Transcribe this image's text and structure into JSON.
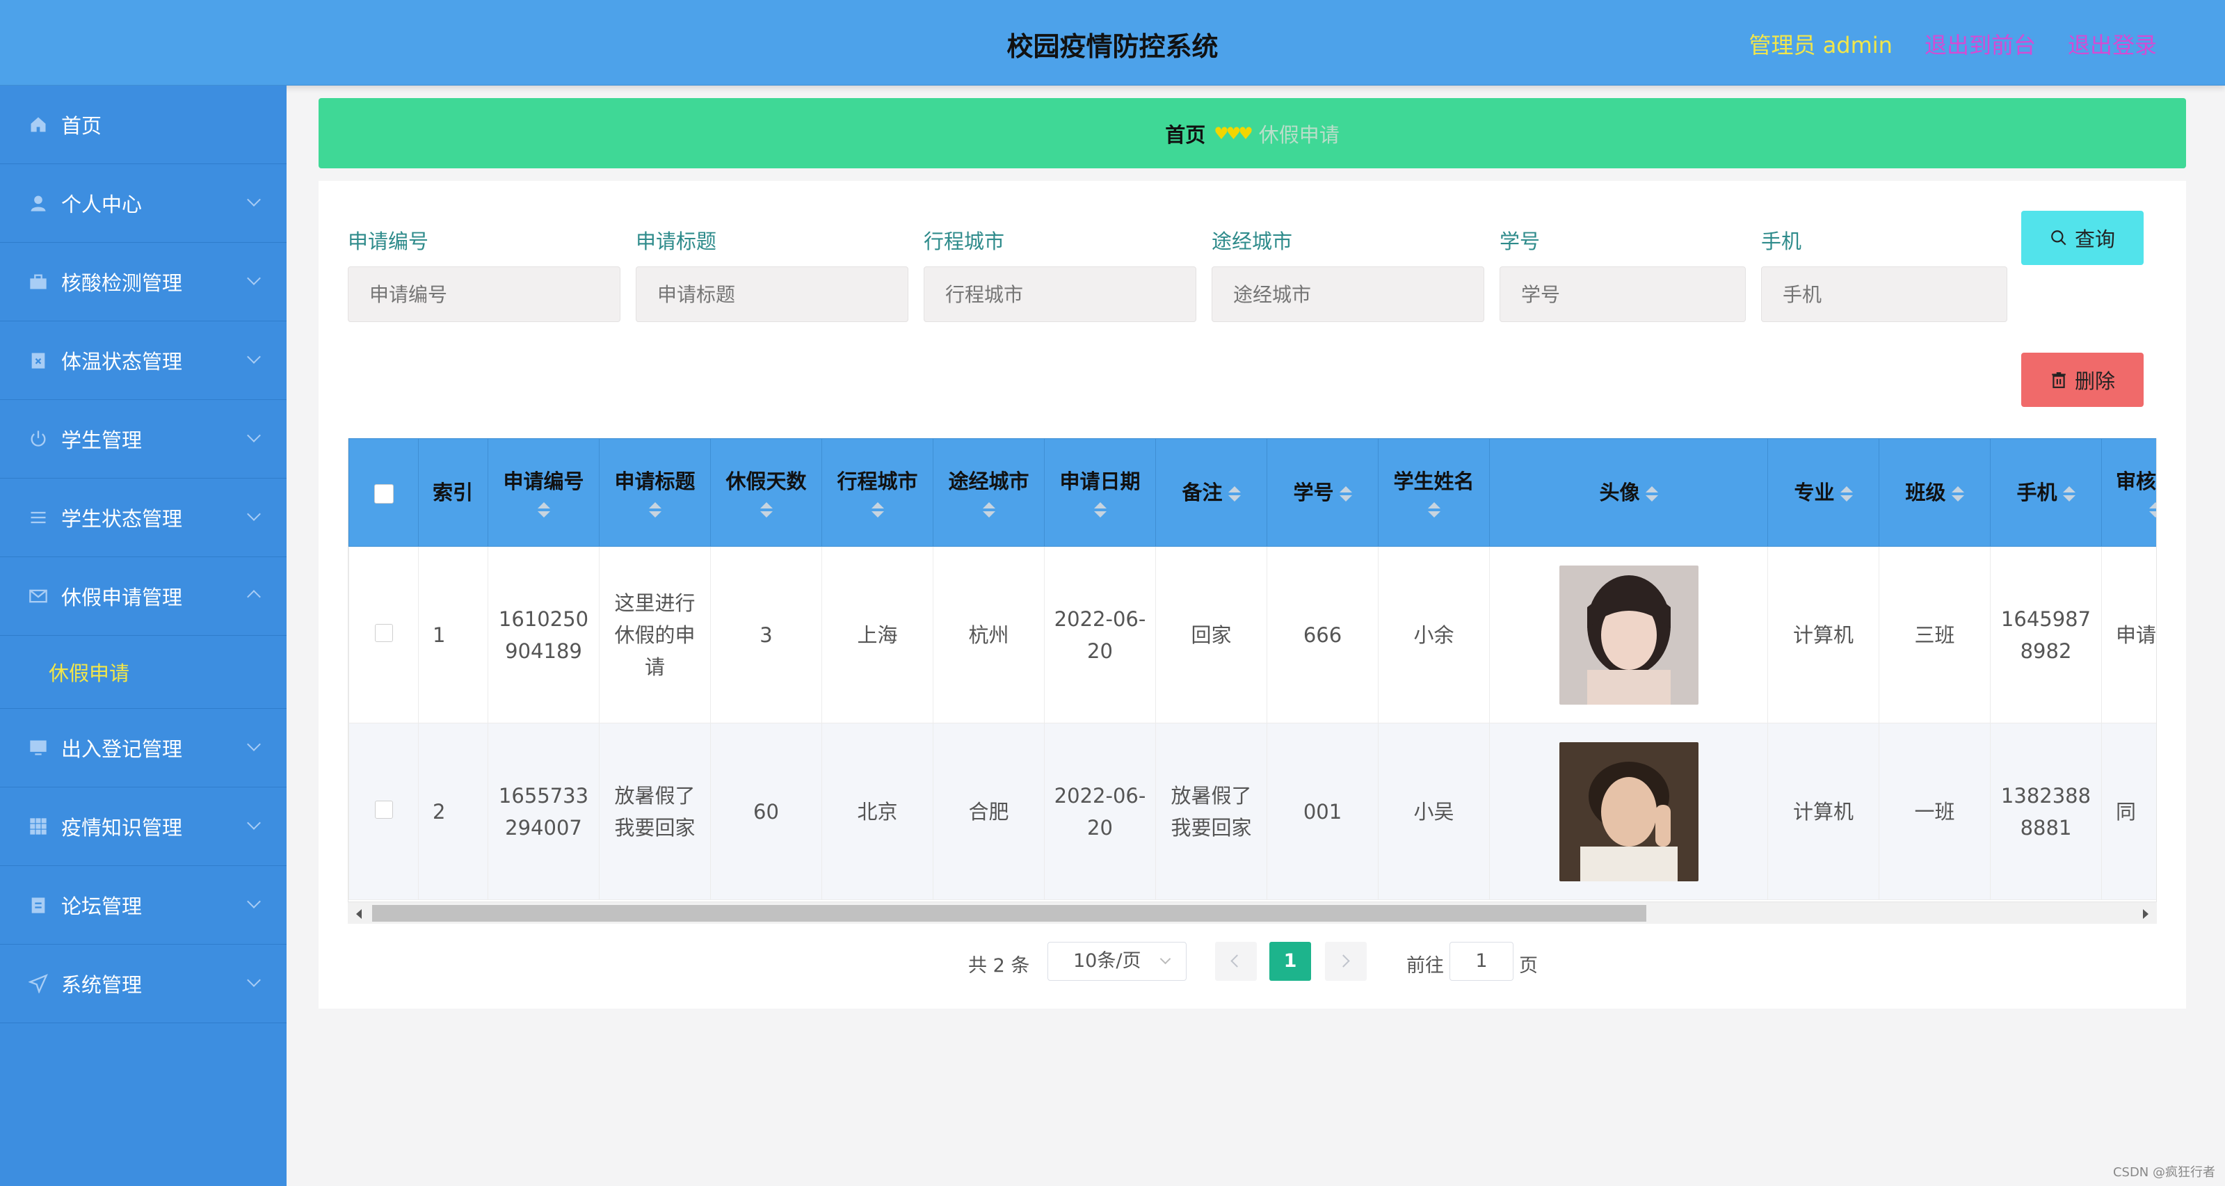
{
  "header": {
    "title": "校园疫情防控系统",
    "admin_label": "管理员 admin",
    "exit_front": "退出到前台",
    "logout": "退出登录"
  },
  "sidebar": {
    "items": [
      {
        "label": "首页",
        "icon": "home-icon"
      },
      {
        "label": "个人中心",
        "icon": "user-icon"
      },
      {
        "label": "核酸检测管理",
        "icon": "suitcase-icon"
      },
      {
        "label": "体温状态管理",
        "icon": "clipboard-x-icon"
      },
      {
        "label": "学生管理",
        "icon": "power-icon"
      },
      {
        "label": "学生状态管理",
        "icon": "list-icon"
      },
      {
        "label": "休假申请管理",
        "icon": "mail-icon"
      },
      {
        "label": "出入登记管理",
        "icon": "monitor-icon"
      },
      {
        "label": "疫情知识管理",
        "icon": "grid-icon"
      },
      {
        "label": "论坛管理",
        "icon": "clipboard-icon"
      },
      {
        "label": "系统管理",
        "icon": "send-icon"
      }
    ],
    "sub_item": "休假申请"
  },
  "breadcrumb": {
    "home": "首页",
    "separator": "♥♥♥",
    "current": "休假申请"
  },
  "search": {
    "fields": [
      {
        "label": "申请编号",
        "placeholder": "申请编号"
      },
      {
        "label": "申请标题",
        "placeholder": "申请标题"
      },
      {
        "label": "行程城市",
        "placeholder": "行程城市"
      },
      {
        "label": "途经城市",
        "placeholder": "途经城市"
      },
      {
        "label": "学号",
        "placeholder": "学号"
      },
      {
        "label": "手机",
        "placeholder": "手机"
      }
    ],
    "query_button": "查询",
    "delete_button": "删除"
  },
  "table": {
    "columns": [
      "索引",
      "申请编号",
      "申请标题",
      "休假天数",
      "行程城市",
      "途经城市",
      "申请日期",
      "备注",
      "学号",
      "学生姓名",
      "头像",
      "专业",
      "班级",
      "手机",
      "审核"
    ],
    "rows": [
      {
        "index": "1",
        "app_no": "1610250904189",
        "title": "这里进行休假的申请",
        "days": "3",
        "trip_city": "上海",
        "via_city": "杭州",
        "date": "2022-06-20",
        "note": "回家",
        "student_no": "666",
        "name": "小余",
        "major": "计算机",
        "class": "三班",
        "phone": "16459878982",
        "review": "申请"
      },
      {
        "index": "2",
        "app_no": "1655733294007",
        "title": "放暑假了我要回家",
        "days": "60",
        "trip_city": "北京",
        "via_city": "合肥",
        "date": "2022-06-20",
        "note": "放暑假了我要回家",
        "student_no": "001",
        "name": "小吴",
        "major": "计算机",
        "class": "一班",
        "phone": "13823888881",
        "review": "同"
      }
    ]
  },
  "pagination": {
    "total": "共 2 条",
    "page_size": "10条/页",
    "current_page": "1",
    "goto_label": "前往",
    "goto_value": "1",
    "page_unit": "页"
  },
  "watermark": "CSDN @疯狂行者",
  "colors": {
    "header": "#4da2ea",
    "sidebar": "#3d8ee0",
    "breadcrumb": "#3fd896",
    "query_button": "#52e3eb",
    "delete_button": "#f06a6a",
    "active_page": "#1db48c",
    "highlight_text": "#f2e64a"
  }
}
